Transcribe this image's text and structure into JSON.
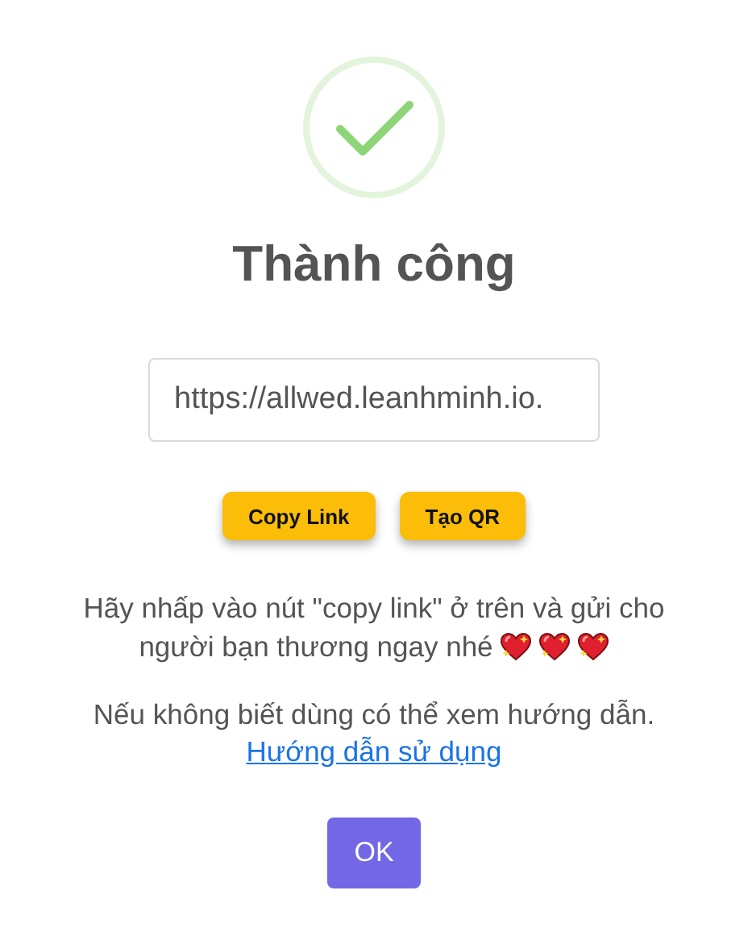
{
  "dialog": {
    "title": "Thành công",
    "link_field": {
      "value": "https://allwed.leanhminh.io."
    },
    "buttons": [
      {
        "label": "Copy Link"
      },
      {
        "label": "Tạo QR"
      }
    ],
    "message": "Hãy nhấp vào nút \"copy link\" ở trên và gửi cho người bạn thương ngay nhé",
    "hearts": [
      {
        "kind": "sparkling-heart"
      },
      {
        "kind": "sparkling-heart"
      },
      {
        "kind": "sparkling-heart"
      }
    ],
    "help_text": "Nếu không biết dùng có thể xem hướng dẫn.",
    "help_link": "Hướng dẫn sử dụng",
    "confirm_button": "OK"
  }
}
